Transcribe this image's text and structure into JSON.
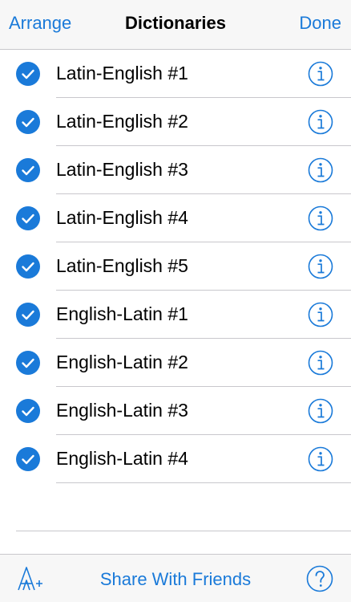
{
  "navbar": {
    "left_label": "Arrange",
    "title": "Dictionaries",
    "right_label": "Done"
  },
  "dictionaries": [
    {
      "label": "Latin-English #1",
      "checked": true
    },
    {
      "label": "Latin-English #2",
      "checked": true
    },
    {
      "label": "Latin-English #3",
      "checked": true
    },
    {
      "label": "Latin-English #4",
      "checked": true
    },
    {
      "label": "Latin-English #5",
      "checked": true
    },
    {
      "label": "English-Latin #1",
      "checked": true
    },
    {
      "label": "English-Latin #2",
      "checked": true
    },
    {
      "label": "English-Latin #3",
      "checked": true
    },
    {
      "label": "English-Latin #4",
      "checked": true
    }
  ],
  "toolbar": {
    "share_label": "Share With Friends",
    "font_icon": "font-size-icon",
    "help_icon": "question-icon"
  },
  "colors": {
    "accent": "#1a7ad9",
    "separator": "#c8c7cc",
    "bar_bg": "#f7f7f7"
  }
}
